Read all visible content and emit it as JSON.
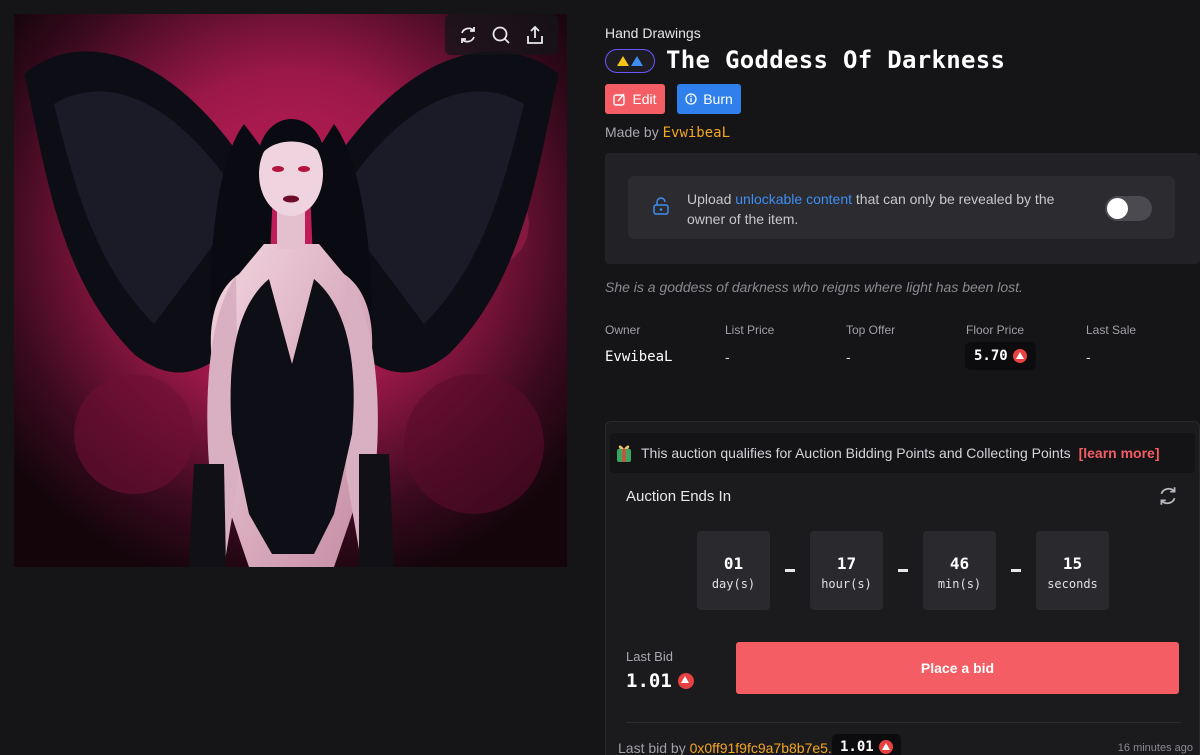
{
  "artwork": {
    "alt": "The Goddess Of Darkness",
    "tools": {
      "refresh_icon": "refresh-icon",
      "zoom_icon": "search-icon",
      "share_icon": "share-icon"
    }
  },
  "item": {
    "category": "Hand Drawings",
    "title": "The Goddess Of Darkness",
    "edit_label": "Edit",
    "burn_label": "Burn",
    "made_by_prefix": "Made by",
    "creator": "EvwibeaL",
    "description": "She is a goddess of darkness who reigns where light has been lost."
  },
  "unlockable": {
    "text_before": "Upload ",
    "link": "unlockable content",
    "text_after": " that can only be revealed by the owner of the item.",
    "enabled": false
  },
  "stats": {
    "owner_label": "Owner",
    "owner_value": "EvwibeaL",
    "list_price_label": "List Price",
    "list_price_value": "-",
    "top_offer_label": "Top Offer",
    "top_offer_value": "-",
    "floor_price_label": "Floor Price",
    "floor_price_value": "5.70",
    "last_sale_label": "Last Sale",
    "last_sale_value": "-"
  },
  "auction": {
    "banner_text": "This auction qualifies for Auction Bidding Points and Collecting Points",
    "learn_more": "[learn more]",
    "ends_label": "Auction Ends In",
    "timer": [
      {
        "value": "01",
        "unit": "day(s)"
      },
      {
        "value": "17",
        "unit": "hour(s)"
      },
      {
        "value": "46",
        "unit": "min(s)"
      },
      {
        "value": "15",
        "unit": "seconds"
      }
    ],
    "separator": "-",
    "last_bid_label": "Last Bid",
    "last_bid_value": "1.01",
    "place_bid_label": "Place a bid",
    "history": {
      "prefix": "Last bid by ",
      "address": "0x0ff91f9fc9a7b8b7e5...",
      "amount": "1.01",
      "time": "16 minutes ago"
    }
  },
  "colors": {
    "accent_red": "#f35d63",
    "accent_blue": "#2f80ed",
    "creator_orange": "#f5a623",
    "avax_red": "#e84142",
    "background": "#151517"
  }
}
